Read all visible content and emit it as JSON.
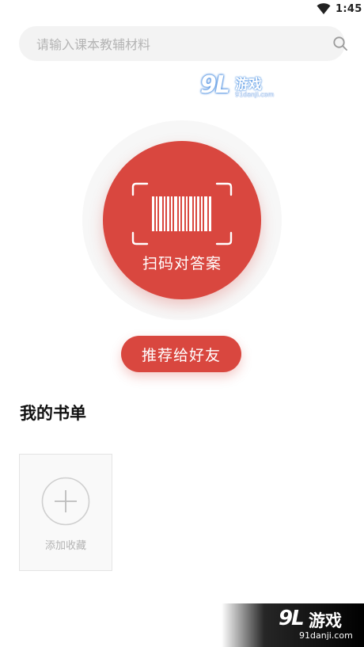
{
  "status_bar": {
    "time": "1:45",
    "wifi_icon": "wifi-icon"
  },
  "search": {
    "placeholder": "请输入课本教辅材料",
    "value": "",
    "icon": "search-icon"
  },
  "watermark_top": {
    "logo": "9L",
    "name": "游戏",
    "url": "91danji.com"
  },
  "scan": {
    "label": "扫码对答案",
    "icon": "barcode-scan-icon"
  },
  "recommend": {
    "label": "推荐给好友"
  },
  "booklist": {
    "title": "我的书单",
    "add_label": "添加收藏",
    "add_icon": "plus-icon"
  },
  "watermark_bottom": {
    "logo": "9L",
    "name": "游戏",
    "url": "91danji.com"
  },
  "colors": {
    "accent": "#d9473f",
    "search_bg": "#f3f3f3",
    "placeholder": "#b4b4b4",
    "card_border": "#e4e4e4"
  }
}
